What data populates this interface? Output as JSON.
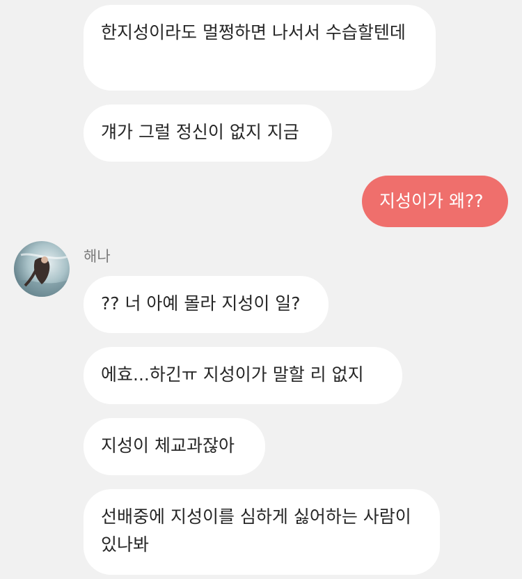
{
  "chat": {
    "messages": [
      {
        "side": "other",
        "text": "한지성이라도 멀쩡하면 나서서 수습할텐데"
      },
      {
        "side": "other",
        "text": "걔가 그럴 정신이 없지 지금"
      },
      {
        "side": "mine",
        "text": "지성이가 왜??"
      },
      {
        "side": "other",
        "sender": "해나",
        "text": "?? 너 아예 몰라 지성이 일?"
      },
      {
        "side": "other",
        "text": "에효...하긴ㅠ 지성이가 말할 리 없지"
      },
      {
        "side": "other",
        "text": "지성이 체교과잖아"
      },
      {
        "side": "other",
        "text": "선배중에 지성이를 심하게 싫어하는 사람이 있나봐"
      }
    ]
  },
  "colors": {
    "background": "#f1f1f1",
    "bubble_other": "#ffffff",
    "bubble_mine": "#ef6f6c",
    "text_other": "#262626",
    "text_mine": "#ffffff",
    "sender_name": "#7a7a7a"
  }
}
